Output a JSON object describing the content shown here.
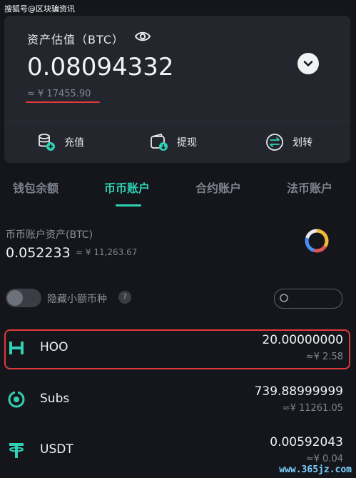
{
  "watermark": {
    "top_left": "搜狐号@区块骗资讯",
    "bottom_right": "www.365jz.com"
  },
  "asset_card": {
    "title": "资产估值（BTC）",
    "balance_btc": "0.08094332",
    "balance_cny": "≈ ¥ 17455.90",
    "actions": [
      {
        "label": "充值",
        "icon": "deposit-icon"
      },
      {
        "label": "提现",
        "icon": "withdraw-icon"
      },
      {
        "label": "划转",
        "icon": "transfer-icon"
      }
    ]
  },
  "tabs": [
    {
      "label": "钱包余额",
      "active": false
    },
    {
      "label": "币币账户",
      "active": true
    },
    {
      "label": "合约账户",
      "active": false
    },
    {
      "label": "法币账户",
      "active": false
    }
  ],
  "account": {
    "label": "币币账户资产(BTC)",
    "balance": "0.052233",
    "cny": "≈ ¥ 11,263.67"
  },
  "filters": {
    "hide_small_label": "隐藏小额币种",
    "help": "?",
    "hide_small_enabled": false
  },
  "coins": [
    {
      "name": "HOO",
      "amount": "20.00000000",
      "value": "≈¥ 2.58",
      "icon": "hoo-icon"
    },
    {
      "name": "Subs",
      "amount": "739.88999999",
      "value": "≈¥ 11261.05",
      "icon": "subs-icon"
    },
    {
      "name": "USDT",
      "amount": "0.00592043",
      "value": "≈¥ 0.04",
      "icon": "usdt-icon"
    }
  ],
  "colors": {
    "accent": "#2fd1b5",
    "highlight": "#e03a3a",
    "background": "#14161b",
    "card": "#23262d"
  }
}
